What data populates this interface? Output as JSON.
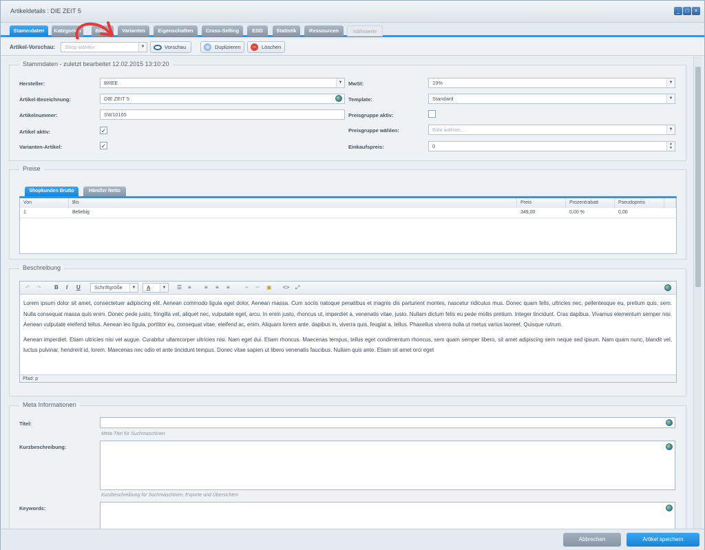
{
  "window": {
    "title": "Artikeldetails : DIE ZEIT 5"
  },
  "tabs": [
    "Stammdaten",
    "Kategorien",
    "Bilder",
    "Varianten",
    "Eigenschaften",
    "Cross-Selling",
    "ESD",
    "Statistik",
    "Ressourcen",
    "Nährwerte"
  ],
  "toolbar": {
    "preview_label": "Artikel-Vorschau:",
    "shop_placeholder": "Shop wählen",
    "preview_button": "Vorschau",
    "duplicate_button": "Duplizieren",
    "delete_button": "Löschen"
  },
  "stammdaten": {
    "legend": "Stammdaten - zuletzt bearbeitet 12.02.2015 13:10:20",
    "hersteller_label": "Hersteller:",
    "hersteller_value": "BREE",
    "bezeichnung_label": "Artikel-Bezeichnung:",
    "bezeichnung_value": "DIE ZEIT 5",
    "nummer_label": "Artikelnummer:",
    "nummer_value": "SW10165",
    "aktiv_label": "Artikel aktiv:",
    "varianten_label": "Varianten-Artikel:",
    "mwst_label": "MwSt:",
    "mwst_value": "19%",
    "template_label": "Template:",
    "template_value": "Standard",
    "preisgruppe_aktiv_label": "Preisgruppe aktiv:",
    "preisgruppe_label": "Preisgruppe wählen:",
    "preisgruppe_placeholder": "Bitte wählen...",
    "einkaufspreis_label": "Einkaufspreis:",
    "einkaufspreis_value": "0"
  },
  "preise": {
    "legend": "Preise",
    "tabs": [
      "Shopkunden Brutto",
      "Händler Netto"
    ],
    "columns": [
      "Von",
      "Bis",
      "Preis",
      "Prozentrabatt",
      "Pseudopreis"
    ],
    "rows": [
      [
        "1",
        "Beliebig",
        "349,00",
        "0,00 %",
        "0,00"
      ]
    ]
  },
  "beschreibung": {
    "legend": "Beschreibung",
    "font_size_label": "Schriftgröße",
    "paragraphs": [
      "Lorem ipsum dolor sit amet, consectetuer adipiscing elit. Aenean commodo ligula eget dolor. Aenean massa. Cum sociis natoque penatibus et magnis dis parturient montes, nascetur ridiculus mus. Donec quam felis, ultricies nec, pellentesque eu, pretium quis, sem. Nulla consequat massa quis enim. Donec pede justo, fringilla vel, aliquet nec, vulputate eget, arcu. In enim justo, rhoncus ut, imperdiet a, venenatis vitae, justo. Nullam dictum felis eu pede mollis pretium. Integer tincidunt. Cras dapibus. Vivamus elementum semper nisi. Aenean vulputate eleifend tellus. Aenean leo ligula, porttitor eu, consequat vitae, eleifend ac, enim. Aliquam lorem ante, dapibus in, viverra quis, feugiat a, tellus. Phasellus viverra nulla ut metus varius laoreet. Quisque rutrum.",
      "Aenean imperdiet. Etiam ultricies nisi vel augue. Curabitur ullamcorper ultricies nisi. Nam eget dui. Etiam rhoncus. Maecenas tempus, tellus eget condimentum rhoncus, sem quam semper libero, sit amet adipiscing sem neque sed ipsum. Nam quam nunc, blandit vel, luctus pulvinar, hendrerit id, lorem. Maecenas nec odio et ante tincidunt tempus. Donec vitae sapien ut libero venenatis faucibus. Nullam quis ante. Etiam sit amet orci eget"
    ],
    "status_path": "Pfad: p"
  },
  "meta": {
    "legend": "Meta Informationen",
    "titel_label": "Titel:",
    "titel_hint": "Meta-Titel für Suchmaschinen",
    "kurz_label": "Kurzbeschreibung:",
    "kurz_hint": "Kurzbeschreibung für Suchmaschinen, Exporte und Übersichten",
    "keywords_label": "Keywords:"
  },
  "footer": {
    "cancel": "Abbrechen",
    "save": "Artikel speichern"
  },
  "colors": {
    "accent": "#189eff",
    "tab_inactive": "#8f9fb1",
    "save": "#1a8fe6",
    "cancel": "#8e9dac"
  }
}
